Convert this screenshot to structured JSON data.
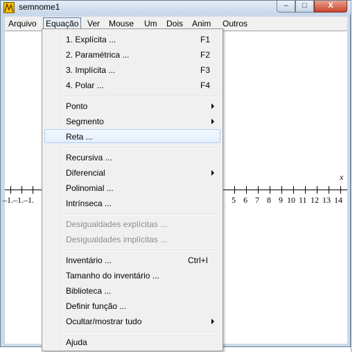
{
  "window": {
    "title": "semnome1"
  },
  "titlebar_buttons": {
    "minimize": "–",
    "maximize": "□",
    "close": "X"
  },
  "menubar": {
    "items": [
      "Arquivo",
      "Equação",
      "Ver",
      "Mouse",
      "Um",
      "Dois",
      "Anim",
      "Outros"
    ],
    "active": "Equação"
  },
  "dropdown": {
    "items": [
      {
        "label": "1. Explícita ...",
        "shortcut": "F1"
      },
      {
        "label": "2. Paramétrica ...",
        "shortcut": "F2"
      },
      {
        "label": "3. Implícita ...",
        "shortcut": "F3"
      },
      {
        "label": "4. Polar ...",
        "shortcut": "F4"
      },
      {
        "label": "Ponto",
        "submenu": true
      },
      {
        "label": "Segmento",
        "submenu": true
      },
      {
        "label": "Reta ...",
        "highlighted": true
      },
      {
        "label": "Recursiva ..."
      },
      {
        "label": "Diferencial",
        "submenu": true
      },
      {
        "label": "Polinomial ..."
      },
      {
        "label": "Intrínseca ..."
      },
      {
        "label": "Desigualdades explícitas ...",
        "disabled": true
      },
      {
        "label": "Desigualdades implícitas ...",
        "disabled": true
      },
      {
        "label": "Inventário ...",
        "shortcut": "Ctrl+I"
      },
      {
        "label": "Tamanho do inventário ..."
      },
      {
        "label": "Biblioteca ..."
      },
      {
        "label": "Definir função ..."
      },
      {
        "label": "Ocultar/mostrar tudo",
        "submenu": true
      },
      {
        "label": "Ajuda"
      }
    ]
  },
  "graph": {
    "x_axis_label": "x",
    "visible_tick_labels_left": "–1.–1.–1.",
    "tick_labels": [
      "5",
      "6",
      "7",
      "8",
      "9",
      "10",
      "11",
      "12",
      "13",
      "14"
    ]
  },
  "colors": {
    "highlight_border": "#aecff7",
    "menu_bg": "#f0f0f0",
    "frame": "#cbd9ea"
  }
}
